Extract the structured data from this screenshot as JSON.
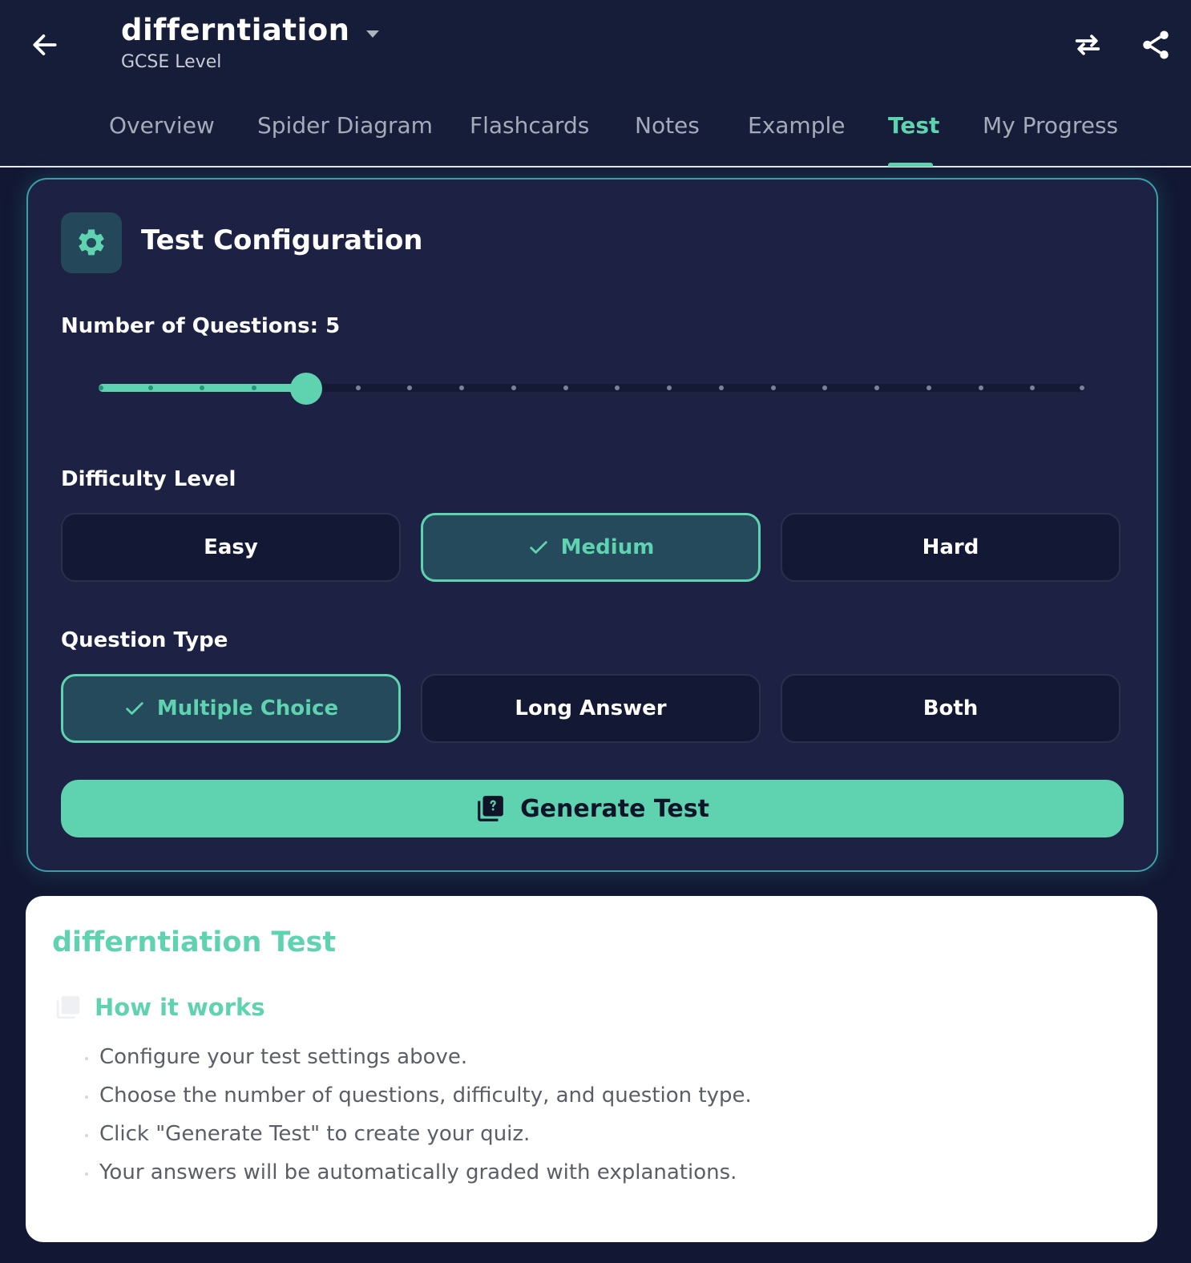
{
  "header": {
    "title": "differntiation",
    "subtitle": "GCSE Level",
    "icons": {
      "back": "arrow-left-icon",
      "dropdown": "caret-down-icon",
      "swap": "swap-arrows-icon",
      "share": "share-icon"
    }
  },
  "tabs": [
    {
      "label": "Overview"
    },
    {
      "label": "Spider Diagram"
    },
    {
      "label": "Flashcards"
    },
    {
      "label": "Notes"
    },
    {
      "label": "Example"
    },
    {
      "label": "Test",
      "active": true
    },
    {
      "label": "My Progress"
    }
  ],
  "config": {
    "title": "Test Configuration",
    "questions_label": "Number of Questions: 5",
    "slider": {
      "value": 5,
      "min": 1,
      "max": 20
    },
    "difficulty_label": "Difficulty Level",
    "difficulty_options": [
      {
        "label": "Easy",
        "selected": false
      },
      {
        "label": "Medium",
        "selected": true
      },
      {
        "label": "Hard",
        "selected": false
      }
    ],
    "type_label": "Question Type",
    "type_options": [
      {
        "label": "Multiple Choice",
        "selected": true
      },
      {
        "label": "Long Answer",
        "selected": false
      },
      {
        "label": "Both",
        "selected": false
      }
    ],
    "generate_label": "Generate Test"
  },
  "info": {
    "title": "differntiation Test",
    "how_title": "How it works",
    "steps": [
      "Configure your test settings above.",
      "Choose the number of questions, difficulty, and question type.",
      "Click \"Generate Test\" to create your quiz.",
      "Your answers will be automatically graded with explanations."
    ]
  },
  "colors": {
    "accent": "#5fd3b0",
    "background": "#121833",
    "header_bg": "#161d38",
    "card_bg": "#1d2244",
    "card_border": "#3aa0a8",
    "selected_bg": "#244a5c",
    "option_bg": "#131834",
    "info_bg": "#ffffff",
    "info_text": "#5a5e66"
  }
}
